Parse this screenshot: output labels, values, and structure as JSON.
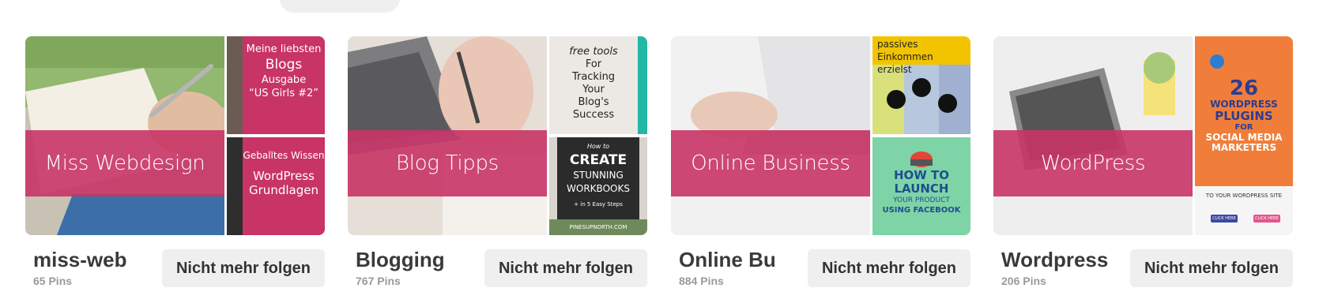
{
  "boards": [
    {
      "title": "miss-web",
      "pins": "65 Pins",
      "follow_label": "Nicht mehr folgen",
      "cover_label": "Miss Webdesign",
      "side1": {
        "line1": "Meine liebsten",
        "line2": "Blogs",
        "line3": "Ausgabe",
        "line4": "“US Girls #2”"
      },
      "side2": {
        "line1": "Geballtes Wissen",
        "line2": "WordPress",
        "line3": "Grundlagen"
      }
    },
    {
      "title": "Blogging",
      "pins": "767 Pins",
      "follow_label": "Nicht mehr folgen",
      "cover_label": "Blog Tipps",
      "side1": {
        "line1": "free tools",
        "line2": "For",
        "line3": "Tracking",
        "line4": "Your",
        "line5": "Blog's",
        "line6": "Success"
      },
      "side2": {
        "line1": "How to",
        "line2": "CREATE",
        "line3": "STUNNING",
        "line4": "WORKBOOKS",
        "line5": "+ in 5 Easy Steps",
        "line6": "PINESUPNORTH.COM"
      }
    },
    {
      "title": "Online Bu",
      "pins": "884 Pins",
      "follow_label": "Nicht mehr folgen",
      "cover_label": "Online Business",
      "side1": {
        "line1": "passives Einkommen",
        "line2": "erzielst"
      },
      "side2": {
        "line1": "HOW TO",
        "line2": "LAUNCH",
        "line3": "YOUR PRODUCT",
        "line4": "USING FACEBOOK"
      }
    },
    {
      "title": "Wordpress",
      "pins": "206 Pins",
      "follow_label": "Nicht mehr folgen",
      "cover_label": "WordPress",
      "side1": {
        "line1": "26",
        "line2": "WORDPRESS",
        "line3": "PLUGINS",
        "line4": "FOR",
        "line5": "SOCIAL MEDIA",
        "line6": "MARKETERS"
      },
      "side2": {
        "line1": "TO YOUR WORDPRESS SITE",
        "line2": "CLICK HERE",
        "line3": "CLICK HERE"
      }
    }
  ]
}
